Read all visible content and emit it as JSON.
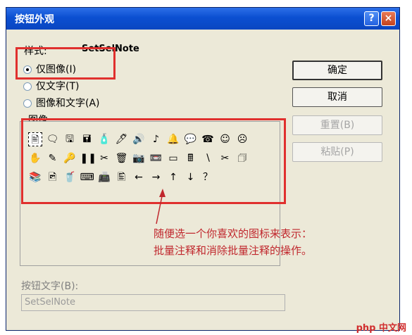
{
  "window": {
    "title": "按钮外观",
    "help_glyph": "?",
    "close_glyph": "×"
  },
  "style": {
    "label": "样式:",
    "current_name": "SetSelNote",
    "options": [
      {
        "label": "仅图像(I)",
        "selected": true
      },
      {
        "label": "仅文字(T)",
        "selected": false
      },
      {
        "label": "图像和文字(A)",
        "selected": false
      }
    ]
  },
  "image_section": {
    "label": "图像"
  },
  "icons": [
    "🖹",
    "🗨",
    "🖫",
    "🖬",
    "🧴",
    "🖊",
    "🔊",
    "♪",
    "🔔",
    "💬",
    "☎",
    "☺",
    "☹",
    "✋",
    "✎",
    "🔑",
    "❚❚",
    "✂",
    "🗑",
    "📷",
    "📼",
    "▭",
    "🖩",
    "∖",
    "✂",
    "🗇",
    "📚",
    "🖻",
    "🥤",
    "⌨",
    "📠",
    "🖺",
    "←",
    "→",
    "↑",
    "↓",
    "？"
  ],
  "buttons": {
    "ok": "确定",
    "cancel": "取消",
    "reset": "重置(B)",
    "paste": "粘贴(P)"
  },
  "button_text": {
    "label": "按钮文字(B):",
    "value": "SetSelNote"
  },
  "annotation": {
    "line1": "随便选一个你喜欢的图标来表示：",
    "line2": "批量注释和消除批量注释的操作。"
  },
  "watermark": "php 中文网"
}
